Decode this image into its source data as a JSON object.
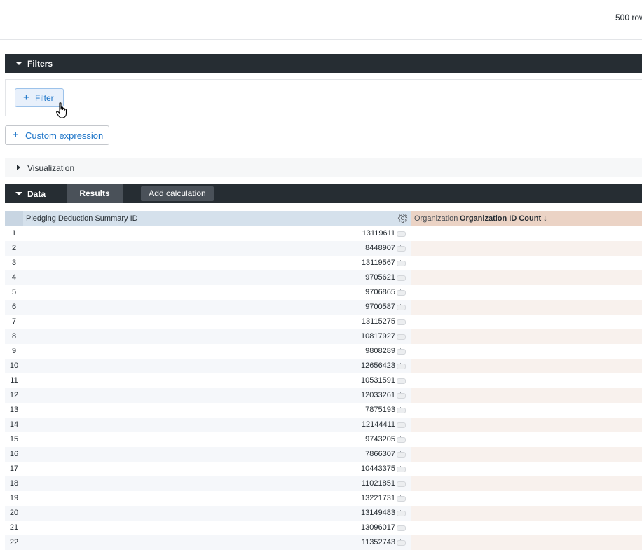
{
  "header": {
    "rows_info": "500 row"
  },
  "filters": {
    "title": "Filters",
    "add_filter_label": "Filter"
  },
  "custom_expression": {
    "label": "Custom expression"
  },
  "visualization": {
    "title": "Visualization"
  },
  "data_bar": {
    "title": "Data",
    "results_tab": "Results",
    "add_calculation": "Add calculation"
  },
  "table": {
    "columns": {
      "dimension": "Pledging Deduction Summary ID",
      "measure_view": "Organization",
      "measure_field": "Organization ID Count",
      "sort_indicator": "↓"
    },
    "rows": [
      {
        "num": "1",
        "id": "13119611"
      },
      {
        "num": "2",
        "id": "8448907"
      },
      {
        "num": "3",
        "id": "13119567"
      },
      {
        "num": "4",
        "id": "9705621"
      },
      {
        "num": "5",
        "id": "9706865"
      },
      {
        "num": "6",
        "id": "9700587"
      },
      {
        "num": "7",
        "id": "13115275"
      },
      {
        "num": "8",
        "id": "10817927"
      },
      {
        "num": "9",
        "id": "9808289"
      },
      {
        "num": "10",
        "id": "12656423"
      },
      {
        "num": "11",
        "id": "10531591"
      },
      {
        "num": "12",
        "id": "12033261"
      },
      {
        "num": "13",
        "id": "7875193"
      },
      {
        "num": "14",
        "id": "12144411"
      },
      {
        "num": "15",
        "id": "9743205"
      },
      {
        "num": "16",
        "id": "7866307"
      },
      {
        "num": "17",
        "id": "10443375"
      },
      {
        "num": "18",
        "id": "11021851"
      },
      {
        "num": "19",
        "id": "13221731"
      },
      {
        "num": "20",
        "id": "13149483"
      },
      {
        "num": "21",
        "id": "13096017"
      },
      {
        "num": "22",
        "id": "11352743"
      }
    ]
  }
}
